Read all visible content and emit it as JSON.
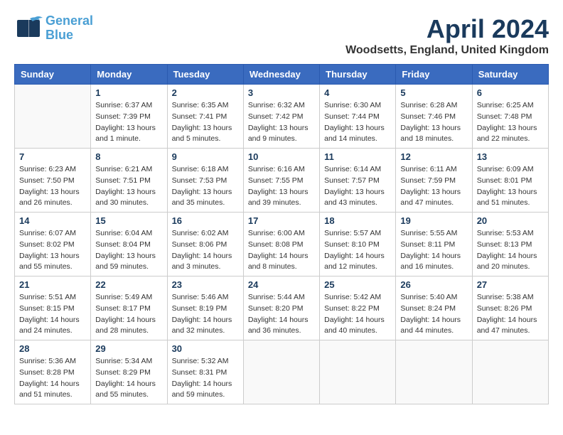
{
  "header": {
    "logo_general": "General",
    "logo_blue": "Blue",
    "title": "April 2024",
    "subtitle": "Woodsetts, England, United Kingdom"
  },
  "days_of_week": [
    "Sunday",
    "Monday",
    "Tuesday",
    "Wednesday",
    "Thursday",
    "Friday",
    "Saturday"
  ],
  "weeks": [
    [
      {
        "day": "",
        "info": ""
      },
      {
        "day": "1",
        "info": "Sunrise: 6:37 AM\nSunset: 7:39 PM\nDaylight: 13 hours\nand 1 minute."
      },
      {
        "day": "2",
        "info": "Sunrise: 6:35 AM\nSunset: 7:41 PM\nDaylight: 13 hours\nand 5 minutes."
      },
      {
        "day": "3",
        "info": "Sunrise: 6:32 AM\nSunset: 7:42 PM\nDaylight: 13 hours\nand 9 minutes."
      },
      {
        "day": "4",
        "info": "Sunrise: 6:30 AM\nSunset: 7:44 PM\nDaylight: 13 hours\nand 14 minutes."
      },
      {
        "day": "5",
        "info": "Sunrise: 6:28 AM\nSunset: 7:46 PM\nDaylight: 13 hours\nand 18 minutes."
      },
      {
        "day": "6",
        "info": "Sunrise: 6:25 AM\nSunset: 7:48 PM\nDaylight: 13 hours\nand 22 minutes."
      }
    ],
    [
      {
        "day": "7",
        "info": "Sunrise: 6:23 AM\nSunset: 7:50 PM\nDaylight: 13 hours\nand 26 minutes."
      },
      {
        "day": "8",
        "info": "Sunrise: 6:21 AM\nSunset: 7:51 PM\nDaylight: 13 hours\nand 30 minutes."
      },
      {
        "day": "9",
        "info": "Sunrise: 6:18 AM\nSunset: 7:53 PM\nDaylight: 13 hours\nand 35 minutes."
      },
      {
        "day": "10",
        "info": "Sunrise: 6:16 AM\nSunset: 7:55 PM\nDaylight: 13 hours\nand 39 minutes."
      },
      {
        "day": "11",
        "info": "Sunrise: 6:14 AM\nSunset: 7:57 PM\nDaylight: 13 hours\nand 43 minutes."
      },
      {
        "day": "12",
        "info": "Sunrise: 6:11 AM\nSunset: 7:59 PM\nDaylight: 13 hours\nand 47 minutes."
      },
      {
        "day": "13",
        "info": "Sunrise: 6:09 AM\nSunset: 8:01 PM\nDaylight: 13 hours\nand 51 minutes."
      }
    ],
    [
      {
        "day": "14",
        "info": "Sunrise: 6:07 AM\nSunset: 8:02 PM\nDaylight: 13 hours\nand 55 minutes."
      },
      {
        "day": "15",
        "info": "Sunrise: 6:04 AM\nSunset: 8:04 PM\nDaylight: 13 hours\nand 59 minutes."
      },
      {
        "day": "16",
        "info": "Sunrise: 6:02 AM\nSunset: 8:06 PM\nDaylight: 14 hours\nand 3 minutes."
      },
      {
        "day": "17",
        "info": "Sunrise: 6:00 AM\nSunset: 8:08 PM\nDaylight: 14 hours\nand 8 minutes."
      },
      {
        "day": "18",
        "info": "Sunrise: 5:57 AM\nSunset: 8:10 PM\nDaylight: 14 hours\nand 12 minutes."
      },
      {
        "day": "19",
        "info": "Sunrise: 5:55 AM\nSunset: 8:11 PM\nDaylight: 14 hours\nand 16 minutes."
      },
      {
        "day": "20",
        "info": "Sunrise: 5:53 AM\nSunset: 8:13 PM\nDaylight: 14 hours\nand 20 minutes."
      }
    ],
    [
      {
        "day": "21",
        "info": "Sunrise: 5:51 AM\nSunset: 8:15 PM\nDaylight: 14 hours\nand 24 minutes."
      },
      {
        "day": "22",
        "info": "Sunrise: 5:49 AM\nSunset: 8:17 PM\nDaylight: 14 hours\nand 28 minutes."
      },
      {
        "day": "23",
        "info": "Sunrise: 5:46 AM\nSunset: 8:19 PM\nDaylight: 14 hours\nand 32 minutes."
      },
      {
        "day": "24",
        "info": "Sunrise: 5:44 AM\nSunset: 8:20 PM\nDaylight: 14 hours\nand 36 minutes."
      },
      {
        "day": "25",
        "info": "Sunrise: 5:42 AM\nSunset: 8:22 PM\nDaylight: 14 hours\nand 40 minutes."
      },
      {
        "day": "26",
        "info": "Sunrise: 5:40 AM\nSunset: 8:24 PM\nDaylight: 14 hours\nand 44 minutes."
      },
      {
        "day": "27",
        "info": "Sunrise: 5:38 AM\nSunset: 8:26 PM\nDaylight: 14 hours\nand 47 minutes."
      }
    ],
    [
      {
        "day": "28",
        "info": "Sunrise: 5:36 AM\nSunset: 8:28 PM\nDaylight: 14 hours\nand 51 minutes."
      },
      {
        "day": "29",
        "info": "Sunrise: 5:34 AM\nSunset: 8:29 PM\nDaylight: 14 hours\nand 55 minutes."
      },
      {
        "day": "30",
        "info": "Sunrise: 5:32 AM\nSunset: 8:31 PM\nDaylight: 14 hours\nand 59 minutes."
      },
      {
        "day": "",
        "info": ""
      },
      {
        "day": "",
        "info": ""
      },
      {
        "day": "",
        "info": ""
      },
      {
        "day": "",
        "info": ""
      }
    ]
  ]
}
